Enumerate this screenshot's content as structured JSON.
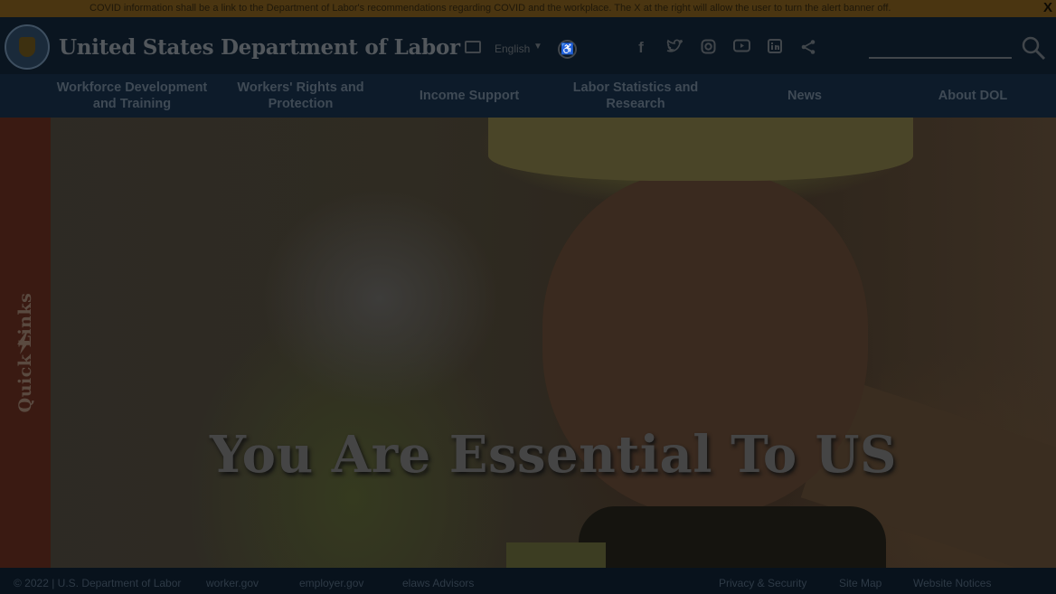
{
  "alert": {
    "text": "COVID information shall be a link to the Department of Labor's recommendations regarding COVID and the workplace. The X at the right will allow the user to turn the alert banner off.",
    "close": "X"
  },
  "header": {
    "title": "United States Department of Labor",
    "language": "English",
    "search_placeholder": ""
  },
  "nav": {
    "items": [
      {
        "label": "Workforce Development and Training"
      },
      {
        "label": "Workers' Rights and Protection"
      },
      {
        "label": "Income Support"
      },
      {
        "label": "Labor Statistics and Research"
      },
      {
        "label": "News"
      },
      {
        "label": "About DOL"
      }
    ]
  },
  "hero": {
    "title": "You Are Essential To US"
  },
  "quick_links": {
    "label": "Quick Links"
  },
  "footer": {
    "copyright": "© 2022 | U.S. Department of Labor",
    "links": [
      "worker.gov",
      "employer.gov",
      "elaws Advisors"
    ],
    "right_links": [
      "Privacy & Security",
      "Site Map",
      "Website Notices"
    ]
  },
  "colors": {
    "overlay": "#000000",
    "header_bg": "#0a1520",
    "quick_links_bg": "#3a1a12",
    "alert_bg": "#4a3511"
  }
}
